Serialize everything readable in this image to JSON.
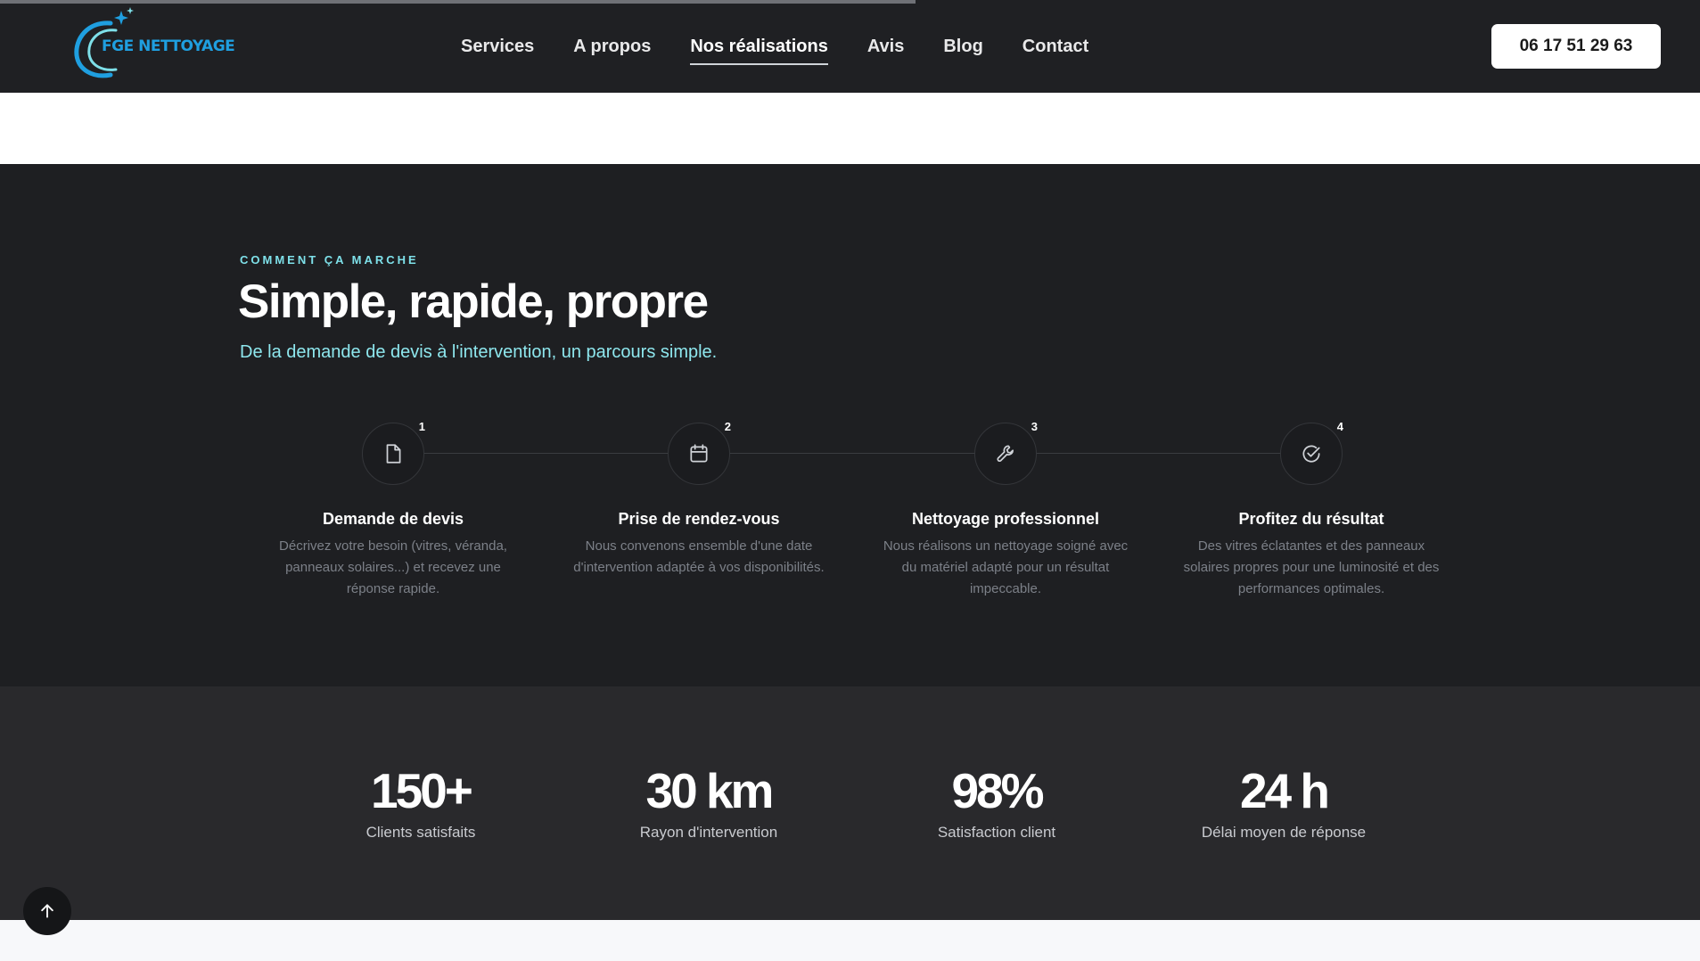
{
  "brand": {
    "name": "FGE NETTOYAGE",
    "accent": "#1f9fe0"
  },
  "nav": {
    "items": [
      {
        "label": "Services"
      },
      {
        "label": "A propos"
      },
      {
        "label": "Nos réalisations",
        "active": true
      },
      {
        "label": "Avis"
      },
      {
        "label": "Blog"
      },
      {
        "label": "Contact"
      }
    ]
  },
  "header": {
    "phone": "06 17 51 29 63"
  },
  "how": {
    "eyebrow": "COMMENT ÇA MARCHE",
    "title": "Simple, rapide, propre",
    "subtitle": "De la demande de devis à l'intervention, un parcours simple.",
    "steps": [
      {
        "number": "1",
        "icon": "document-icon",
        "title": "Demande de devis",
        "desc": "Décrivez votre besoin (vitres, véranda, panneaux solaires...) et recevez une réponse rapide."
      },
      {
        "number": "2",
        "icon": "calendar-icon",
        "title": "Prise de rendez-vous",
        "desc": "Nous convenons ensemble d'une date d'intervention adaptée à vos disponibilités."
      },
      {
        "number": "3",
        "icon": "wrench-icon",
        "title": "Nettoyage professionnel",
        "desc": "Nous réalisons un nettoyage soigné avec du matériel adapté pour un résultat impeccable."
      },
      {
        "number": "4",
        "icon": "check-circle-icon",
        "title": "Profitez du résultat",
        "desc": "Des vitres éclatantes et des panneaux solaires propres pour une luminosité et des performances optimales."
      }
    ]
  },
  "stats": [
    {
      "value": "150+",
      "label": "Clients satisfaits"
    },
    {
      "value": "30 km",
      "label": "Rayon d'intervention"
    },
    {
      "value": "98%",
      "label": "Satisfaction client"
    },
    {
      "value": "24 h",
      "label": "Délai moyen de réponse"
    }
  ]
}
